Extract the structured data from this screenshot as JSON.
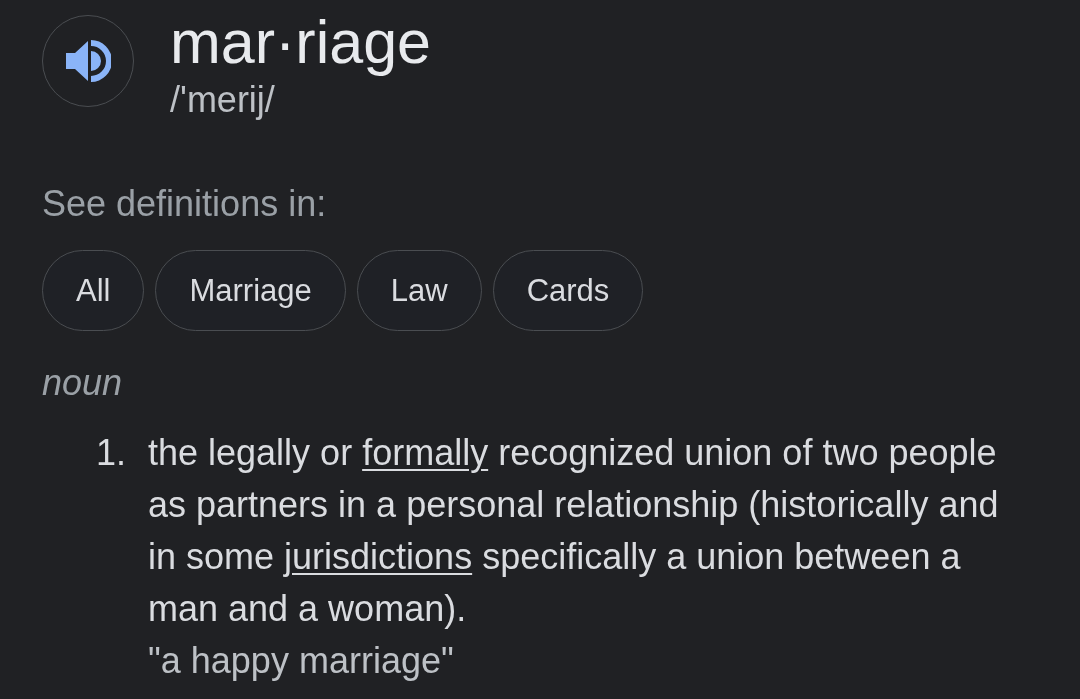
{
  "entry": {
    "headword": "mar·riage",
    "pronunciation": "/'merij/"
  },
  "sources": {
    "label": "See definitions in:",
    "chips": [
      "All",
      "Marriage",
      "Law",
      "Cards"
    ]
  },
  "part_of_speech": "noun",
  "definitions": [
    {
      "number": "1.",
      "parts": [
        {
          "kind": "text",
          "text": "the legally or "
        },
        {
          "kind": "link",
          "text": "formally"
        },
        {
          "kind": "text",
          "text": " recognized union of two people as partners in a personal relationship (historically and in some "
        },
        {
          "kind": "link",
          "text": "jurisdictions"
        },
        {
          "kind": "text",
          "text": " specifically a union between a man and a woman)."
        }
      ],
      "example": "\"a happy marriage\""
    }
  ]
}
